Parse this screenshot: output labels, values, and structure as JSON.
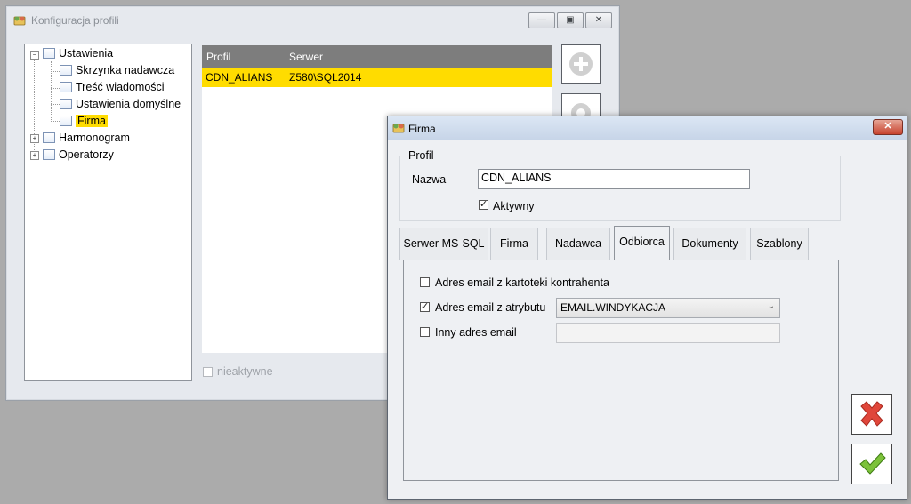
{
  "main_window": {
    "title": "Konfiguracja profili",
    "tree": [
      {
        "label": "Ustawienia"
      },
      {
        "label": "Skrzynka nadawcza"
      },
      {
        "label": "Treść wiadomości"
      },
      {
        "label": "Ustawienia domyślne"
      },
      {
        "label": "Firma"
      },
      {
        "label": "Harmonogram"
      },
      {
        "label": "Operatorzy"
      }
    ],
    "grid": {
      "columns": [
        "Profil",
        "Serwer"
      ],
      "rows": [
        [
          "CDN_ALIANS",
          "Z580\\SQL2014"
        ]
      ]
    },
    "inactive_label": "nieaktywne"
  },
  "dialog": {
    "title": "Firma",
    "profile_group_label": "Profil",
    "name_label": "Nazwa",
    "name_value": "CDN_ALIANS",
    "active_label": "Aktywny",
    "tabs": [
      "Serwer MS-SQL",
      "Firma",
      "Nadawca",
      "Odbiorca",
      "Dokumenty",
      "Szablony"
    ],
    "options": {
      "from_contractor": "Adres email z kartoteki kontrahenta",
      "from_attribute": "Adres email z atrybutu",
      "attribute_value": "EMAIL.WINDYKACJA",
      "other": "Inny adres email"
    }
  },
  "colors": {
    "selection": "#ffdc00",
    "grid_header": "#7d7d7d",
    "cancel": "#d9352a",
    "ok": "#5aab1e"
  }
}
